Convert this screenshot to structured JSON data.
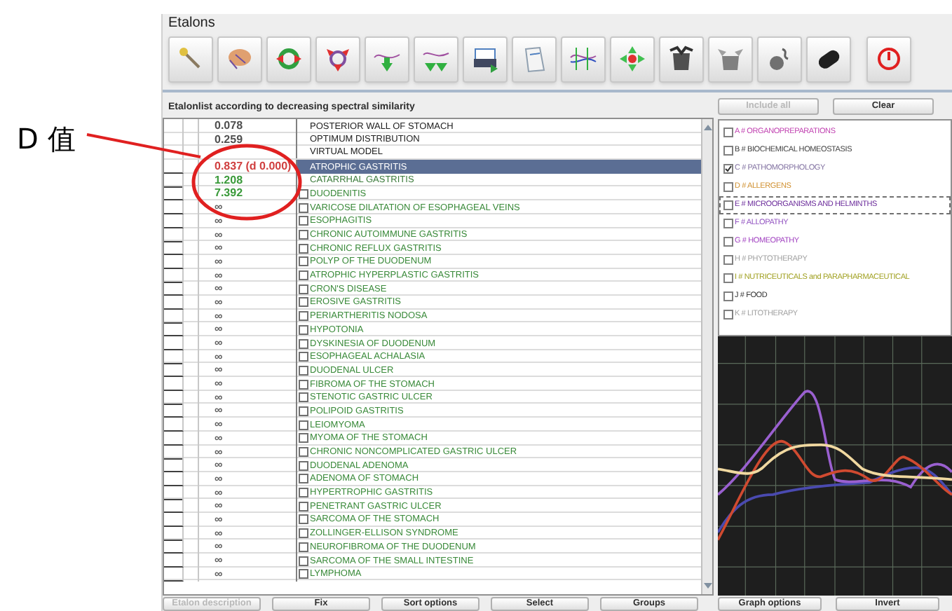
{
  "annotation": {
    "label": "D 值"
  },
  "window": {
    "title": "Etalons"
  },
  "list_caption": "Etalonlist according to decreasing spectral similarity",
  "rows": [
    {
      "kind": "reference",
      "value": "0.078",
      "color": "#505050",
      "name": "POSTERIOR WALL OF STOMACH",
      "selected": false
    },
    {
      "kind": "reference",
      "value": "0.259",
      "color": "#505050",
      "name": "OPTIMUM DISTRIBUTION",
      "selected": false
    },
    {
      "kind": "reference",
      "name": "VIRTUAL MODEL",
      "selected": false
    },
    {
      "kind": "match",
      "value": "0.837 (d 0.000)",
      "color": "#d04040",
      "name": "ATROPHIC GASTRITIS",
      "selected": true
    },
    {
      "kind": "match",
      "value": "1.208",
      "color": "#3a9a3a",
      "name": "CATARRHAL GASTRITIS",
      "selected": false
    },
    {
      "kind": "etalon",
      "value": "7.392",
      "color": "#3a9a3a",
      "name": "DUODENITIS",
      "selected": false,
      "checked": false
    },
    {
      "kind": "etalon",
      "value": "∞",
      "color": "#606060",
      "name": "VARICOSE DILATATION OF ESOPHAGEAL VEINS",
      "selected": false,
      "checked": false
    },
    {
      "kind": "etalon",
      "value": "∞",
      "color": "#606060",
      "name": "ESOPHAGITIS",
      "selected": false,
      "checked": false
    },
    {
      "kind": "etalon",
      "value": "∞",
      "color": "#606060",
      "name": "CHRONIC AUTOIMMUNE GASTRITIS",
      "selected": false,
      "checked": false
    },
    {
      "kind": "etalon",
      "value": "∞",
      "color": "#606060",
      "name": "CHRONIC REFLUX GASTRITIS",
      "selected": false,
      "checked": false
    },
    {
      "kind": "etalon",
      "value": "∞",
      "color": "#606060",
      "name": "POLYP OF THE DUODENUM",
      "selected": false,
      "checked": false
    },
    {
      "kind": "etalon",
      "value": "∞",
      "color": "#606060",
      "name": "ATROPHIC HYPERPLASTIC GASTRITIS",
      "selected": false,
      "checked": false
    },
    {
      "kind": "etalon",
      "value": "∞",
      "color": "#606060",
      "name": "CRON'S DISEASE",
      "selected": false,
      "checked": false
    },
    {
      "kind": "etalon",
      "value": "∞",
      "color": "#606060",
      "name": "EROSIVE GASTRITIS",
      "selected": false,
      "checked": false
    },
    {
      "kind": "etalon",
      "value": "∞",
      "color": "#606060",
      "name": "PERIARTHERITIS NODOSA",
      "selected": false,
      "checked": false
    },
    {
      "kind": "etalon",
      "value": "∞",
      "color": "#606060",
      "name": "HYPOTONIA",
      "selected": false,
      "checked": false
    },
    {
      "kind": "etalon",
      "value": "∞",
      "color": "#606060",
      "name": "DYSKINESIA OF DUODENUM",
      "selected": false,
      "checked": false
    },
    {
      "kind": "etalon",
      "value": "∞",
      "color": "#606060",
      "name": "ESOPHAGEAL ACHALASIA",
      "selected": false,
      "checked": false
    },
    {
      "kind": "etalon",
      "value": "∞",
      "color": "#606060",
      "name": "DUODENAL ULCER",
      "selected": false,
      "checked": false
    },
    {
      "kind": "etalon",
      "value": "∞",
      "color": "#606060",
      "name": "FIBROMA OF THE STOMACH",
      "selected": false,
      "checked": false
    },
    {
      "kind": "etalon",
      "value": "∞",
      "color": "#606060",
      "name": "STENOTIC GASTRIC ULCER",
      "selected": false,
      "checked": false
    },
    {
      "kind": "etalon",
      "value": "∞",
      "color": "#606060",
      "name": "POLIPOID GASTRITIS",
      "selected": false,
      "checked": false
    },
    {
      "kind": "etalon",
      "value": "∞",
      "color": "#606060",
      "name": "LEIOMYOMA",
      "selected": false,
      "checked": false
    },
    {
      "kind": "etalon",
      "value": "∞",
      "color": "#606060",
      "name": "MYOMA OF THE STOMACH",
      "selected": false,
      "checked": false
    },
    {
      "kind": "etalon",
      "value": "∞",
      "color": "#606060",
      "name": "CHRONIC NONCOMPLICATED GASTRIC ULCER",
      "selected": false,
      "checked": false
    },
    {
      "kind": "etalon",
      "value": "∞",
      "color": "#606060",
      "name": "DUODENAL ADENOMA",
      "selected": false,
      "checked": false
    },
    {
      "kind": "etalon",
      "value": "∞",
      "color": "#606060",
      "name": "ADENOMA OF STOMACH",
      "selected": false,
      "checked": false
    },
    {
      "kind": "etalon",
      "value": "∞",
      "color": "#606060",
      "name": "HYPERTROPHIC GASTRITIS",
      "selected": false,
      "checked": false
    },
    {
      "kind": "etalon",
      "value": "∞",
      "color": "#606060",
      "name": "PENETRANT GASTRIC ULCER",
      "selected": false,
      "checked": false
    },
    {
      "kind": "etalon",
      "value": "∞",
      "color": "#606060",
      "name": "SARCOMA OF THE STOMACH",
      "selected": false,
      "checked": false
    },
    {
      "kind": "etalon",
      "value": "∞",
      "color": "#606060",
      "name": "ZOLLINGER-ELLISON SYNDROME",
      "selected": false,
      "checked": false
    },
    {
      "kind": "etalon",
      "value": "∞",
      "color": "#606060",
      "name": "NEUROFIBROMA OF THE DUODENUM",
      "selected": false,
      "checked": false
    },
    {
      "kind": "etalon",
      "value": "∞",
      "color": "#606060",
      "name": "SARCOMA OF THE SMALL INTESTINE",
      "selected": false,
      "checked": false
    },
    {
      "kind": "etalon",
      "value": "∞",
      "color": "#606060",
      "name": "LYMPHOMA",
      "selected": false,
      "checked": false
    }
  ],
  "left_buttons": [
    {
      "label": "Etalon description",
      "disabled": true
    },
    {
      "label": "Fix",
      "disabled": false
    },
    {
      "label": "Sort options",
      "disabled": false
    },
    {
      "label": "Select",
      "disabled": false
    },
    {
      "label": "Groups",
      "disabled": false
    }
  ],
  "group_buttons": [
    {
      "label": "Include all",
      "disabled": true
    },
    {
      "label": "Clear",
      "disabled": false
    }
  ],
  "groups": [
    {
      "label": "A # ORGANOPREPARATIONS",
      "color": "#c040b0",
      "checked": false,
      "focused": false
    },
    {
      "label": "B # BIOCHEMICAL HOMEOSTASIS",
      "color": "#404040",
      "checked": false,
      "focused": false
    },
    {
      "label": "C # PATHOMORPHOLOGY",
      "color": "#8070a0",
      "checked": true,
      "focused": false
    },
    {
      "label": "D # ALLERGENS",
      "color": "#d09030",
      "checked": false,
      "focused": false
    },
    {
      "label": "E # MICROORGANISMS AND HELMINTHS",
      "color": "#6a2a9a",
      "checked": false,
      "focused": true
    },
    {
      "label": "F # ALLOPATHY",
      "color": "#9050c0",
      "checked": false,
      "focused": false
    },
    {
      "label": "G # HOMEOPATHY",
      "color": "#a040c0",
      "checked": false,
      "focused": false
    },
    {
      "label": "H # PHYTOTHERAPY",
      "color": "#a0a0a0",
      "checked": false,
      "focused": false
    },
    {
      "label": "I # NUTRICEUTICALS and PARAPHARMACEUTICAL",
      "color": "#a0a020",
      "checked": false,
      "focused": false
    },
    {
      "label": "J # FOOD",
      "color": "#303030",
      "checked": false,
      "focused": false
    },
    {
      "label": "K # LITOTHERAPY",
      "color": "#a0a0a0",
      "checked": false,
      "focused": false
    }
  ],
  "right_buttons": [
    {
      "label": "Graph options",
      "disabled": false
    },
    {
      "label": "Invert",
      "disabled": false
    }
  ]
}
